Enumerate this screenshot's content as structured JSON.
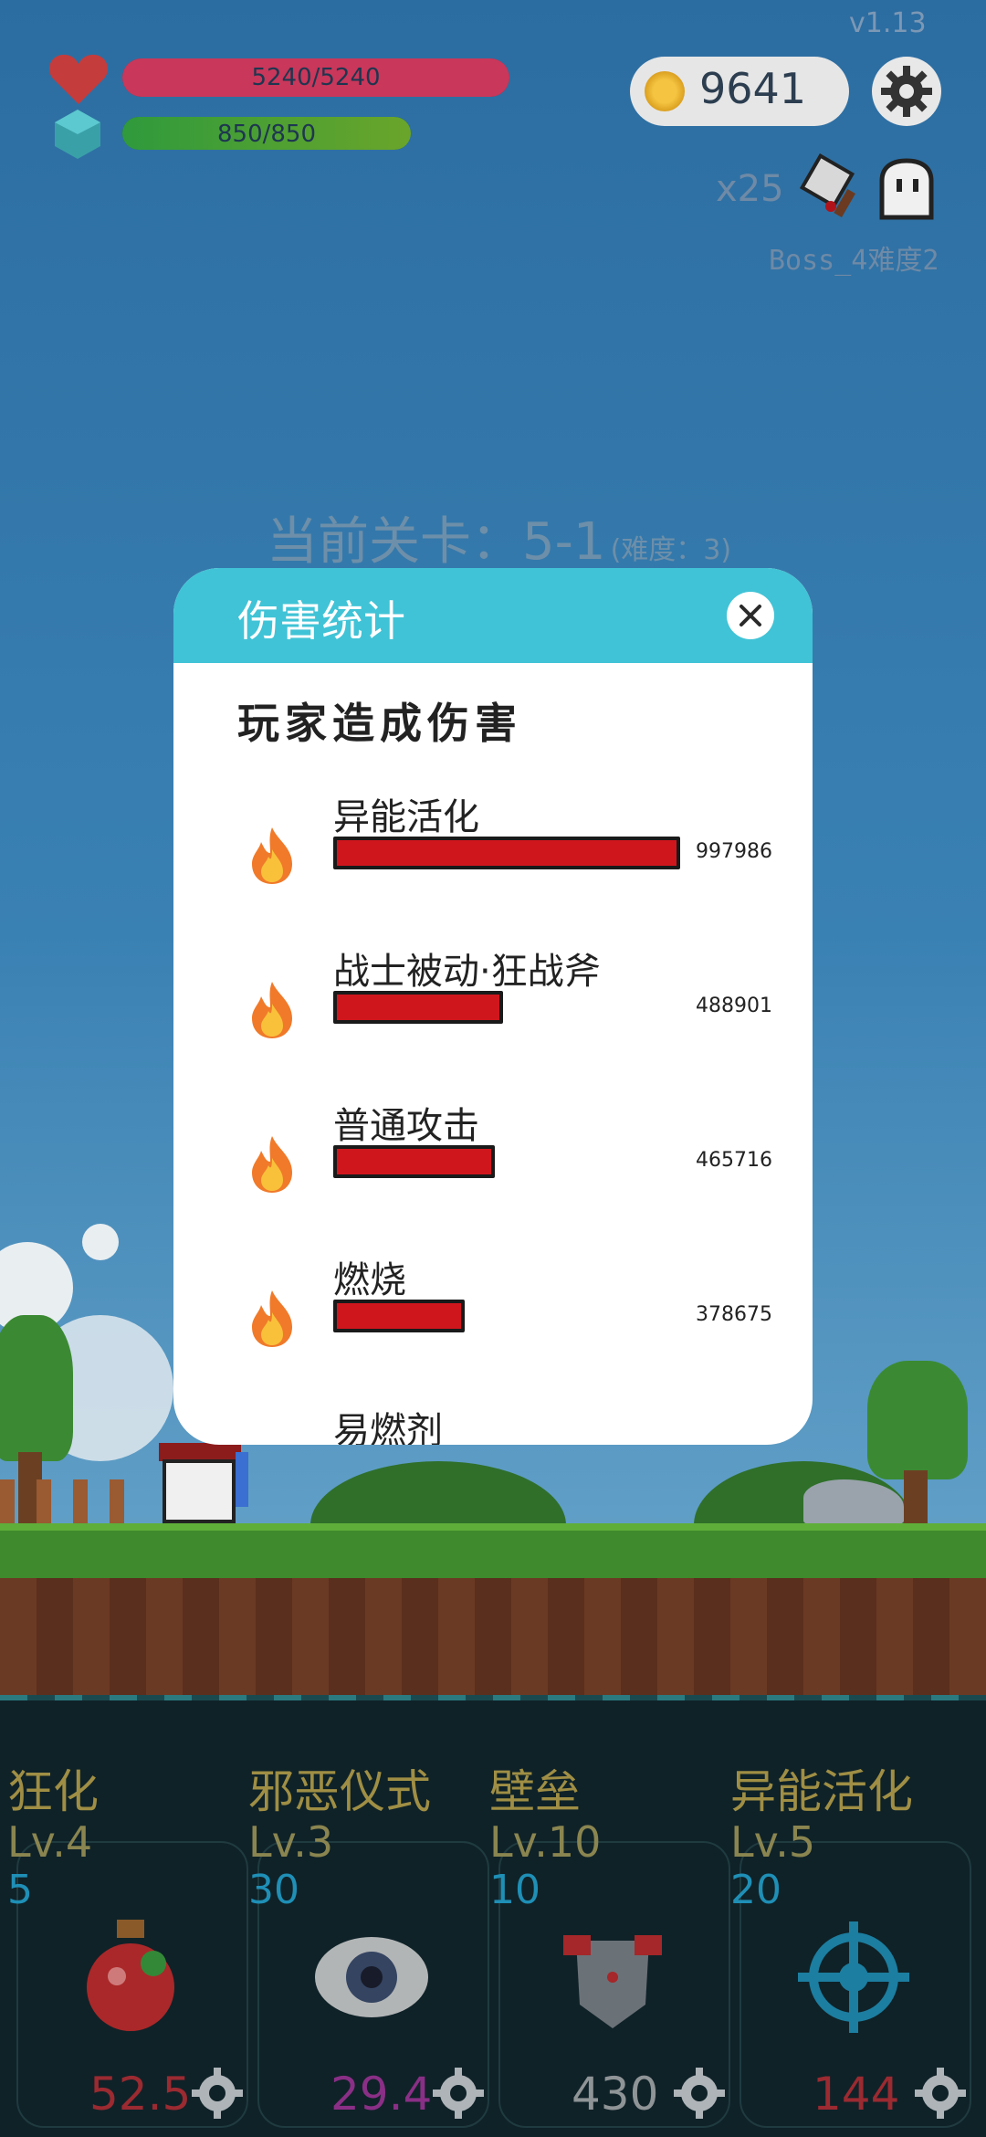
{
  "version": "v1.13",
  "hud": {
    "hp_text": "5240/5240",
    "hp_fraction": 1.0,
    "mp_text": "850/850",
    "mp_fraction": 1.0,
    "coins": "9641",
    "multiplier": "x25",
    "boss_label": "Boss_4难度2"
  },
  "stage": {
    "label": "当前关卡：5-1",
    "difficulty": "(难度：3)"
  },
  "modal": {
    "title": "伤害统计",
    "section_title": "玩家造成伤害",
    "rows": [
      {
        "name": "异能活化",
        "value": "997986",
        "fraction": 1.0
      },
      {
        "name": "战士被动·狂战斧",
        "value": "488901",
        "fraction": 0.49
      },
      {
        "name": "普通攻击",
        "value": "465716",
        "fraction": 0.467
      },
      {
        "name": "燃烧",
        "value": "378675",
        "fraction": 0.38
      },
      {
        "name": "易燃剂",
        "value": "",
        "fraction": 0
      }
    ]
  },
  "skills": [
    {
      "name": "狂化",
      "level": "Lv.4",
      "cost": "5",
      "value": "52.5",
      "value_color": "#9b2a31",
      "icon": "potion-icon"
    },
    {
      "name": "邪恶仪式",
      "level": "Lv.3",
      "cost": "30",
      "value": "29.4",
      "value_color": "#8a2f86",
      "icon": "eye-icon"
    },
    {
      "name": "壁垒",
      "level": "Lv.10",
      "cost": "10",
      "value": "430",
      "value_color": "#8f9496",
      "icon": "armor-icon"
    },
    {
      "name": "异能活化",
      "level": "Lv.5",
      "cost": "20",
      "value": "144",
      "value_color": "#9b2a31",
      "icon": "crosshair-icon"
    }
  ],
  "colors": {
    "modal_header": "#40c3d6",
    "damage_bar": "#d0161d",
    "hp_bar": "#c9375a",
    "mp_bar": "#2f9a3c"
  }
}
